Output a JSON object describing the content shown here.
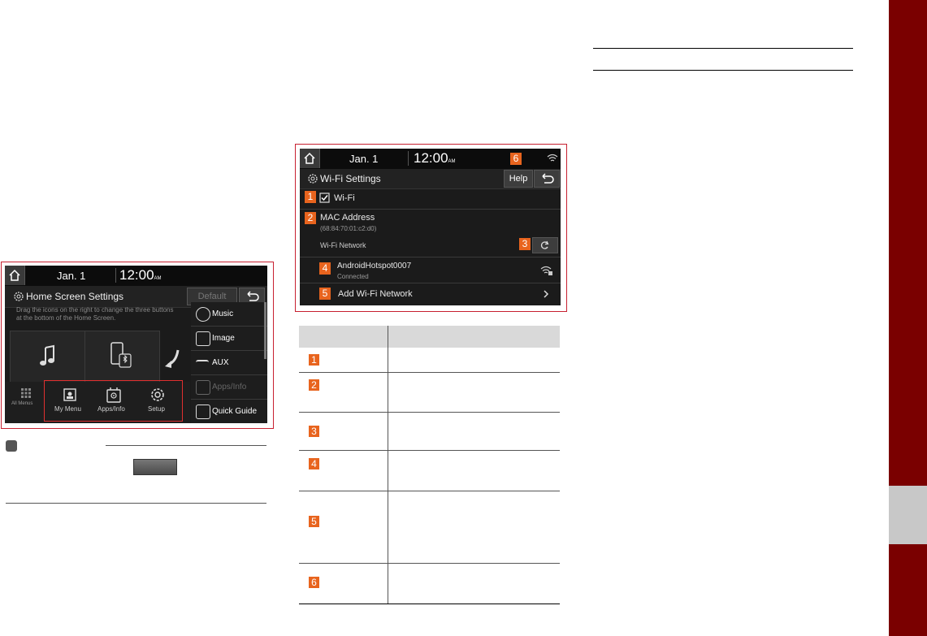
{
  "home_screen": {
    "date": "Jan.  1",
    "time": "12:00",
    "ampm": "AM",
    "title": "Home Screen Settings",
    "default_btn": "Default",
    "description": "Drag the icons on the right to change the three buttons at the bottom of the Home Screen.",
    "all_menus": "All Menus",
    "bottom_buttons": [
      "My Menu",
      "Apps/Info",
      "Setup"
    ],
    "side_items": [
      "Music",
      "Image",
      "AUX",
      "Apps/Info",
      "Quick Guide"
    ]
  },
  "wifi_screen": {
    "date": "Jan.  1",
    "time": "12:00",
    "ampm": "AM",
    "title": "Wi-Fi Settings",
    "help": "Help",
    "wifi_label": "Wi-Fi",
    "mac_label": "MAC Address",
    "mac_value": "(68:84:70:01:c2:d0)",
    "network_label": "Wi-Fi Network",
    "hotspot_name": "AndroidHotspot0007",
    "hotspot_status": "Connected",
    "add_network": "Add Wi-Fi Network"
  },
  "badges": [
    "1",
    "2",
    "3",
    "4",
    "5",
    "6"
  ],
  "colors": {
    "accent_red": "#7a0000",
    "badge_orange": "#e8641e",
    "frame_red": "#c72030"
  },
  "icons": [
    "home-icon",
    "gear-icon",
    "back-icon",
    "refresh-icon",
    "chevron-right-icon",
    "wifi-icon",
    "wifi-lock-icon",
    "music-icon",
    "image-icon",
    "aux-icon",
    "apps-icon",
    "guide-icon",
    "grid-icon",
    "my-menu-icon",
    "setup-icon",
    "phone-bluetooth-icon",
    "arrow-down-left-icon",
    "checkbox-icon"
  ]
}
